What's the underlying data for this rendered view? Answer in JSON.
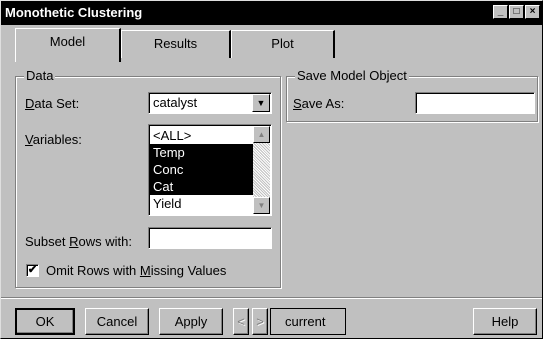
{
  "window": {
    "title": "Monothetic Clustering",
    "controls": [
      "minimize-icon",
      "maximize-icon",
      "close-icon"
    ]
  },
  "tabs": [
    {
      "label": "Model",
      "active": true
    },
    {
      "label": "Results",
      "active": false
    },
    {
      "label": "Plot",
      "active": false
    }
  ],
  "data_group": {
    "title": "Data",
    "dataset_label_prefix": "",
    "dataset_label_underlined": "D",
    "dataset_label_rest": "ata Set:",
    "dataset_value": "catalyst",
    "variables_label_underlined": "V",
    "variables_label_rest": "ariables:",
    "variables": [
      {
        "label": "<ALL>",
        "selected": false
      },
      {
        "label": "Temp",
        "selected": true
      },
      {
        "label": "Conc",
        "selected": true
      },
      {
        "label": "Cat",
        "selected": true
      },
      {
        "label": "Yield",
        "selected": false
      }
    ],
    "subset_label_prefix": "Subset ",
    "subset_label_underlined": "R",
    "subset_label_rest": "ows with:",
    "subset_value": "",
    "omit_label_prefix": "Omit Rows with ",
    "omit_label_underlined": "M",
    "omit_label_rest": "issing Values",
    "omit_checked": true
  },
  "save_group": {
    "title": "Save Model Object",
    "save_label_underlined": "S",
    "save_label_rest": "ave As:",
    "save_value": ""
  },
  "buttons": {
    "ok": "OK",
    "cancel": "Cancel",
    "apply": "Apply",
    "prev": "<",
    "next": ">",
    "current": "current",
    "help": "Help"
  }
}
